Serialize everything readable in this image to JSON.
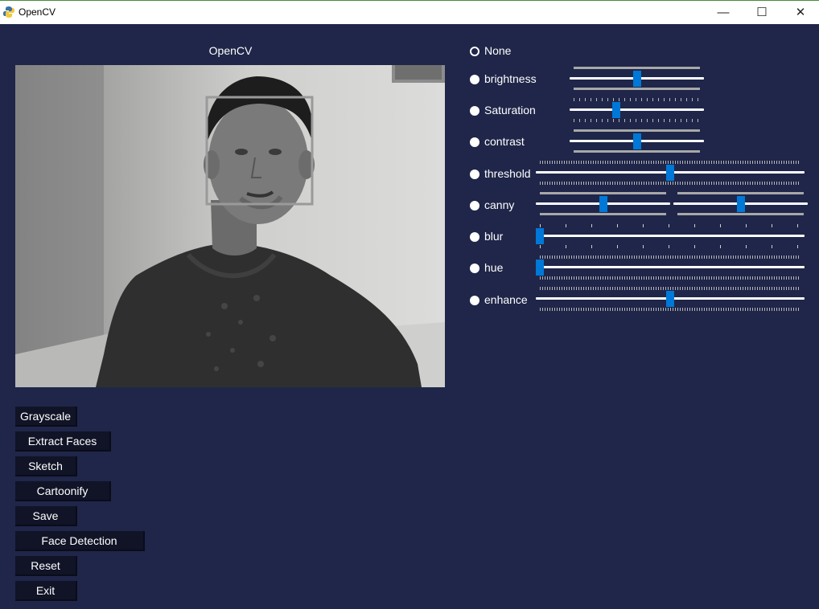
{
  "window": {
    "title": "OpenCV",
    "minimize_glyph": "—",
    "maximize_glyph": "☐",
    "close_glyph": "✕"
  },
  "video": {
    "caption": "OpenCV"
  },
  "buttons": {
    "grayscale": "Grayscale",
    "extract_faces": "Extract Faces",
    "sketch": "Sketch",
    "cartoonify": "Cartoonify",
    "save": "Save",
    "face_detection": "Face Detection",
    "reset": "Reset",
    "exit": "Exit"
  },
  "filters": {
    "none": "None",
    "brightness": "brightness",
    "saturation": "Saturation",
    "contrast": "contrast",
    "threshold": "threshold",
    "canny": "canny",
    "blur": "blur",
    "hue": "hue",
    "enhance": "enhance"
  },
  "slider_levels": {
    "brightness": 0.5,
    "saturation": 0.34,
    "contrast": 0.5,
    "threshold": 0.5,
    "canny_low": 0.5,
    "canny_high": 0.5,
    "blur": 0.0,
    "hue": 0.0,
    "enhance": 0.5
  },
  "colors": {
    "background": "#1f2649",
    "button": "#111427",
    "slider_thumb": "#0078d7"
  }
}
